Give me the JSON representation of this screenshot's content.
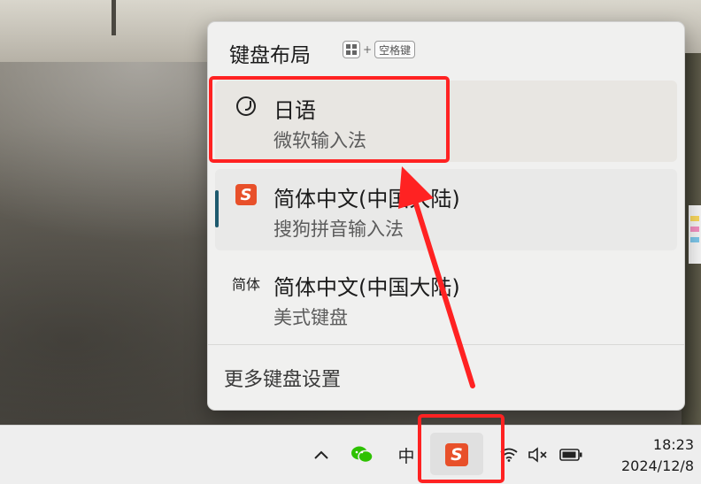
{
  "flyout": {
    "title": "键盘布局",
    "shortcut_plus": "+",
    "shortcut_key": "空格键",
    "items": [
      {
        "name": "日语",
        "sub": "微软输入法",
        "icon": "japanese-ime-icon",
        "icon_text": ""
      },
      {
        "name": "简体中文(中国大陆)",
        "sub": "搜狗拼音输入法",
        "icon": "sogou-icon",
        "icon_text": "S"
      },
      {
        "name": "简体中文(中国大陆)",
        "sub": "美式键盘",
        "icon": "text-icon",
        "icon_text": "简体"
      }
    ],
    "more_settings": "更多键盘设置"
  },
  "taskbar": {
    "chevron": "∧",
    "ime_mode": "中",
    "sogou_label": "S",
    "time": "18:23",
    "date": "2024/12/8"
  },
  "colors": {
    "highlight": "#ff2222",
    "sogou": "#e8502a",
    "indicator": "#1e5a6e",
    "wechat": "#2dc100"
  }
}
